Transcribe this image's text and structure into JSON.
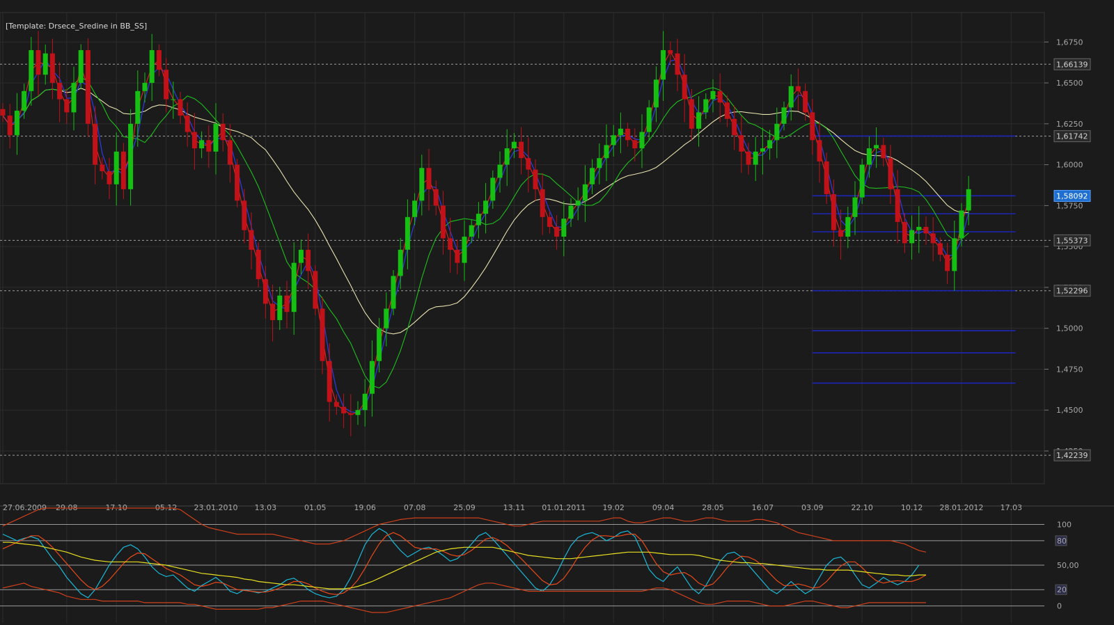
{
  "template_label": "[Template: Drsece_Sredine in BB_SS]",
  "colors": {
    "background": "#1b1b1b",
    "grid": "#2c2c2c",
    "axis_text": "#a8a8a8",
    "bull": "#16c012",
    "bear": "#c01218",
    "ma_blue": "#2a3ad8",
    "ma_red": "#e42424",
    "ma_green": "#1ec01e",
    "ma_cream": "#e8e2b0",
    "fib_line": "#1c26b8",
    "marker_bg": "#2a2a2a",
    "marker_current_bg": "#1e6fd0",
    "osc_red": "#e84a1a",
    "osc_cyan": "#1ab8d8",
    "osc_yellow": "#e8e020",
    "osc_band_red": "#d0401a"
  },
  "chart_data": [
    {
      "type": "candlestick",
      "title": "",
      "y_range": [
        1.405,
        1.693
      ],
      "y_ticks": [
        "1,6750",
        "1,6500",
        "1,6250",
        "1,6000",
        "1,5750",
        "1,5500",
        "1,5250",
        "1,5000",
        "1,4750",
        "1,4500",
        "1,4250"
      ],
      "y_tick_values": [
        1.675,
        1.65,
        1.625,
        1.6,
        1.575,
        1.55,
        1.525,
        1.5,
        1.475,
        1.45,
        1.425
      ],
      "x_labels": [
        "27.06.2009",
        "29.08",
        "17.10",
        "05.12",
        "23.01.2010",
        "13.03",
        "01.05",
        "19.06",
        "07.08",
        "25.09",
        "13.11",
        "01.01.2011",
        "19.02",
        "09.04",
        "28.05",
        "16.07",
        "03.09",
        "22.10",
        "10.12",
        "28.01.2012",
        "17.03"
      ],
      "x_label_index": [
        0,
        9,
        16,
        23,
        30,
        37,
        44,
        51,
        58,
        65,
        72,
        79,
        86,
        93,
        100,
        107,
        114,
        121,
        128,
        135,
        142
      ],
      "horizontal_levels": [
        {
          "label": "1,66139",
          "value": 1.66139,
          "current": false
        },
        {
          "label": "1,61742",
          "value": 1.61742,
          "current": false
        },
        {
          "label": "1,58092",
          "value": 1.58092,
          "current": true
        },
        {
          "label": "1,55373",
          "value": 1.55373,
          "current": false
        },
        {
          "label": "1,52296",
          "value": 1.52296,
          "current": false
        },
        {
          "label": "1,42239",
          "value": 1.42239,
          "current": false
        }
      ],
      "fib_lines": {
        "start_index": 114,
        "end_index": 142,
        "values": [
          1.6175,
          1.581,
          1.57,
          1.559,
          1.523,
          1.4985,
          1.485,
          1.4665
        ]
      },
      "closes": [
        1.63,
        1.618,
        1.633,
        1.645,
        1.67,
        1.655,
        1.668,
        1.65,
        1.64,
        1.632,
        1.65,
        1.67,
        1.625,
        1.6,
        1.596,
        1.588,
        1.608,
        1.585,
        1.625,
        1.645,
        1.65,
        1.67,
        1.658,
        1.64,
        1.64,
        1.63,
        1.62,
        1.61,
        1.615,
        1.608,
        1.625,
        1.615,
        1.6,
        1.578,
        1.56,
        1.548,
        1.53,
        1.515,
        1.505,
        1.52,
        1.51,
        1.54,
        1.548,
        1.535,
        1.512,
        1.48,
        1.455,
        1.452,
        1.448,
        1.447,
        1.45,
        1.46,
        1.48,
        1.5,
        1.512,
        1.532,
        1.548,
        1.568,
        1.578,
        1.598,
        1.585,
        1.575,
        1.555,
        1.548,
        1.54,
        1.556,
        1.563,
        1.57,
        1.578,
        1.592,
        1.6,
        1.61,
        1.614,
        1.604,
        1.597,
        1.585,
        1.568,
        1.562,
        1.556,
        1.567,
        1.575,
        1.578,
        1.588,
        1.598,
        1.604,
        1.612,
        1.618,
        1.622,
        1.615,
        1.61,
        1.62,
        1.635,
        1.652,
        1.67,
        1.668,
        1.655,
        1.64,
        1.622,
        1.632,
        1.64,
        1.645,
        1.638,
        1.628,
        1.618,
        1.608,
        1.6,
        1.608,
        1.61,
        1.615,
        1.625,
        1.635,
        1.648,
        1.645,
        1.632,
        1.615,
        1.602,
        1.582,
        1.56,
        1.556,
        1.568,
        1.58,
        1.6,
        1.61,
        1.612,
        1.604,
        1.585,
        1.565,
        1.552,
        1.56,
        1.562,
        1.558,
        1.552,
        1.545,
        1.535,
        1.555,
        1.572,
        1.585,
        null,
        null,
        null,
        null,
        null,
        null,
        null,
        null
      ],
      "osc_ticks": [
        "100",
        "80",
        "50,00",
        "20",
        "0"
      ],
      "osc_tick_values": [
        100,
        80,
        50,
        20,
        0
      ],
      "osc_range": [
        -8,
        120
      ],
      "osc_series": [
        {
          "key": "cyan",
          "values": [
            88,
            84,
            80,
            83,
            85,
            82,
            70,
            58,
            48,
            35,
            25,
            15,
            10,
            20,
            35,
            50,
            62,
            72,
            75,
            70,
            60,
            48,
            40,
            36,
            38,
            30,
            22,
            18,
            25,
            30,
            35,
            28,
            18,
            15,
            20,
            18,
            16,
            18,
            22,
            26,
            32,
            34,
            28,
            20,
            15,
            12,
            10,
            12,
            20,
            35,
            55,
            75,
            88,
            95,
            90,
            78,
            68,
            60,
            65,
            70,
            72,
            68,
            62,
            55,
            58,
            66,
            76,
            86,
            90,
            82,
            72,
            62,
            52,
            42,
            32,
            22,
            18,
            26,
            40,
            58,
            74,
            84,
            88,
            90,
            86,
            80,
            84,
            90,
            92,
            85,
            66,
            45,
            35,
            30,
            40,
            48,
            35,
            22,
            15,
            25,
            40,
            55,
            64,
            66,
            60,
            50,
            40,
            30,
            20,
            15,
            22,
            30,
            22,
            15,
            20,
            35,
            50,
            58,
            60,
            52,
            38,
            26,
            22,
            28,
            35,
            30,
            26,
            30,
            38,
            50
          ]
        },
        {
          "key": "red",
          "values": [
            70,
            74,
            78,
            82,
            86,
            86,
            80,
            72,
            62,
            52,
            42,
            32,
            24,
            20,
            24,
            32,
            42,
            52,
            60,
            65,
            64,
            58,
            52,
            46,
            42,
            38,
            32,
            26,
            24,
            26,
            29,
            28,
            24,
            20,
            19,
            18,
            17,
            17,
            19,
            22,
            26,
            30,
            30,
            27,
            22,
            18,
            15,
            14,
            16,
            22,
            32,
            46,
            62,
            76,
            86,
            90,
            86,
            79,
            72,
            70,
            70,
            70,
            67,
            63,
            61,
            63,
            68,
            75,
            82,
            84,
            80,
            74,
            66,
            58,
            49,
            40,
            31,
            26,
            27,
            34,
            46,
            60,
            72,
            81,
            86,
            86,
            85,
            86,
            88,
            88,
            80,
            66,
            52,
            42,
            38,
            40,
            41,
            36,
            28,
            24,
            27,
            36,
            47,
            56,
            61,
            60,
            56,
            49,
            40,
            31,
            25,
            25,
            27,
            25,
            22,
            23,
            30,
            40,
            49,
            54,
            54,
            47,
            38,
            31,
            28,
            30,
            31,
            30,
            30,
            33,
            38
          ]
        },
        {
          "key": "yellow",
          "values": [
            78,
            78,
            77,
            76,
            75,
            74,
            72,
            70,
            68,
            66,
            63,
            60,
            58,
            56,
            55,
            54,
            54,
            54,
            54,
            54,
            53,
            52,
            51,
            50,
            48,
            46,
            44,
            42,
            40,
            39,
            38,
            37,
            36,
            35,
            33,
            32,
            30,
            29,
            28,
            27,
            26,
            26,
            25,
            24,
            23,
            22,
            21,
            21,
            21,
            22,
            24,
            27,
            30,
            34,
            38,
            42,
            46,
            50,
            54,
            58,
            62,
            66,
            68,
            70,
            71,
            72,
            72,
            72,
            72,
            72,
            70,
            68,
            66,
            64,
            62,
            61,
            60,
            59,
            58,
            58,
            58,
            59,
            60,
            61,
            62,
            63,
            64,
            65,
            66,
            66,
            66,
            66,
            65,
            64,
            63,
            63,
            63,
            63,
            62,
            60,
            58,
            56,
            55,
            54,
            53,
            53,
            52,
            52,
            51,
            50,
            49,
            48,
            47,
            46,
            45,
            45,
            44,
            44,
            44,
            44,
            43,
            42,
            41,
            40,
            39,
            38,
            38,
            37,
            37,
            38,
            38
          ]
        },
        {
          "key": "band_upper",
          "values": [
            98,
            102,
            106,
            110,
            114,
            118,
            122,
            126,
            130,
            134,
            138,
            142,
            146,
            150,
            154,
            158,
            160,
            160,
            160,
            160,
            150,
            140,
            132,
            126,
            122,
            118,
            112,
            106,
            100,
            96,
            94,
            92,
            90,
            88,
            88,
            88,
            88,
            88,
            88,
            86,
            84,
            82,
            80,
            78,
            76,
            76,
            76,
            78,
            80,
            84,
            88,
            92,
            96,
            100,
            102,
            104,
            106,
            107,
            108,
            108,
            108,
            108,
            108,
            108,
            108,
            108,
            108,
            108,
            106,
            104,
            102,
            100,
            98,
            98,
            100,
            102,
            104,
            104,
            104,
            104,
            104,
            104,
            104,
            104,
            104,
            106,
            108,
            108,
            104,
            102,
            102,
            104,
            106,
            108,
            108,
            106,
            104,
            104,
            106,
            108,
            108,
            106,
            104,
            104,
            104,
            104,
            106,
            106,
            104,
            102,
            98,
            94,
            90,
            88,
            86,
            84,
            82,
            80,
            80,
            80,
            80,
            80,
            80,
            80,
            80,
            80,
            78,
            76,
            72,
            68,
            66
          ]
        },
        {
          "key": "band_lower",
          "values": [
            22,
            24,
            26,
            28,
            24,
            22,
            20,
            18,
            16,
            12,
            10,
            8,
            8,
            8,
            6,
            6,
            6,
            6,
            6,
            6,
            4,
            4,
            4,
            4,
            4,
            4,
            2,
            2,
            0,
            -2,
            -4,
            -4,
            -4,
            -4,
            -4,
            -4,
            -4,
            -2,
            -2,
            0,
            2,
            4,
            6,
            6,
            6,
            6,
            4,
            2,
            0,
            -2,
            -4,
            -6,
            -8,
            -8,
            -8,
            -6,
            -4,
            -2,
            0,
            2,
            4,
            6,
            8,
            10,
            14,
            18,
            22,
            26,
            28,
            28,
            26,
            24,
            22,
            20,
            18,
            18,
            18,
            18,
            18,
            18,
            18,
            18,
            18,
            18,
            18,
            18,
            18,
            18,
            18,
            18,
            18,
            20,
            22,
            22,
            20,
            16,
            12,
            8,
            4,
            2,
            2,
            4,
            6,
            6,
            6,
            6,
            4,
            2,
            0,
            0,
            0,
            2,
            4,
            6,
            6,
            4,
            2,
            0,
            -2,
            -2,
            0,
            2,
            4,
            4,
            4,
            4,
            4,
            4,
            4,
            4,
            4
          ]
        }
      ]
    }
  ]
}
